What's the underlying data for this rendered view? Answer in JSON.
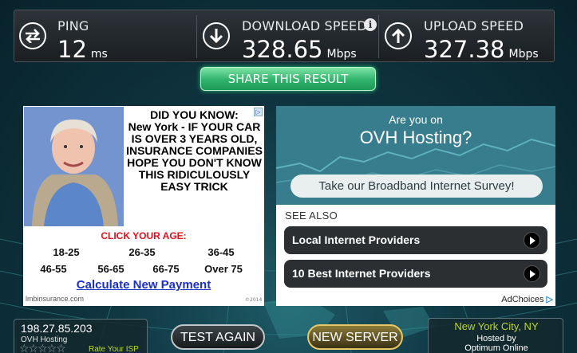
{
  "stats": {
    "ping": {
      "label": "PING",
      "value": "12",
      "unit": "ms"
    },
    "download": {
      "label": "DOWNLOAD SPEED",
      "value": "328.65",
      "unit": "Mbps"
    },
    "upload": {
      "label": "UPLOAD SPEED",
      "value": "327.38",
      "unit": "Mbps"
    }
  },
  "share_label": "SHARE THIS RESULT",
  "ad_left": {
    "headline_1": "DID YOU KNOW:",
    "headline_2": "New York - IF YOUR CAR IS OVER 3 YEARS OLD, INSURANCE COMPANIES HOPE YOU DON'T KNOW THIS RIDICULOUSLY EASY TRICK",
    "age_prompt": "CLICK YOUR AGE:",
    "ages": [
      "18-25",
      "26-35",
      "36-45",
      "46-55",
      "56-65",
      "66-75",
      "Over 75"
    ],
    "cta": "Calculate New Payment",
    "domain": "lmbinsurance.com",
    "copyright": "©2014"
  },
  "ad_right": {
    "question_1": "Are you on",
    "question_2": "OVH Hosting?",
    "survey": "Take our Broadband Internet Survey!",
    "see_also": "SEE ALSO",
    "links": [
      "Local Internet Providers",
      "10 Best Internet Providers"
    ],
    "adchoices": "AdChoices"
  },
  "server": {
    "ip": "198.27.85.203",
    "host": "OVH Hosting",
    "rate": "Rate Your ISP"
  },
  "buttons": {
    "test_again": "TEST AGAIN",
    "new_server": "NEW SERVER"
  },
  "location": {
    "city": "New York City, NY",
    "hosted_by": "Hosted by",
    "isp": "Optimum Online"
  },
  "colors": {
    "accent_green": "#2fb36b",
    "location_green": "#b9d72e",
    "ad_red": "#e0121b",
    "link_blue": "#1a2fc8"
  }
}
